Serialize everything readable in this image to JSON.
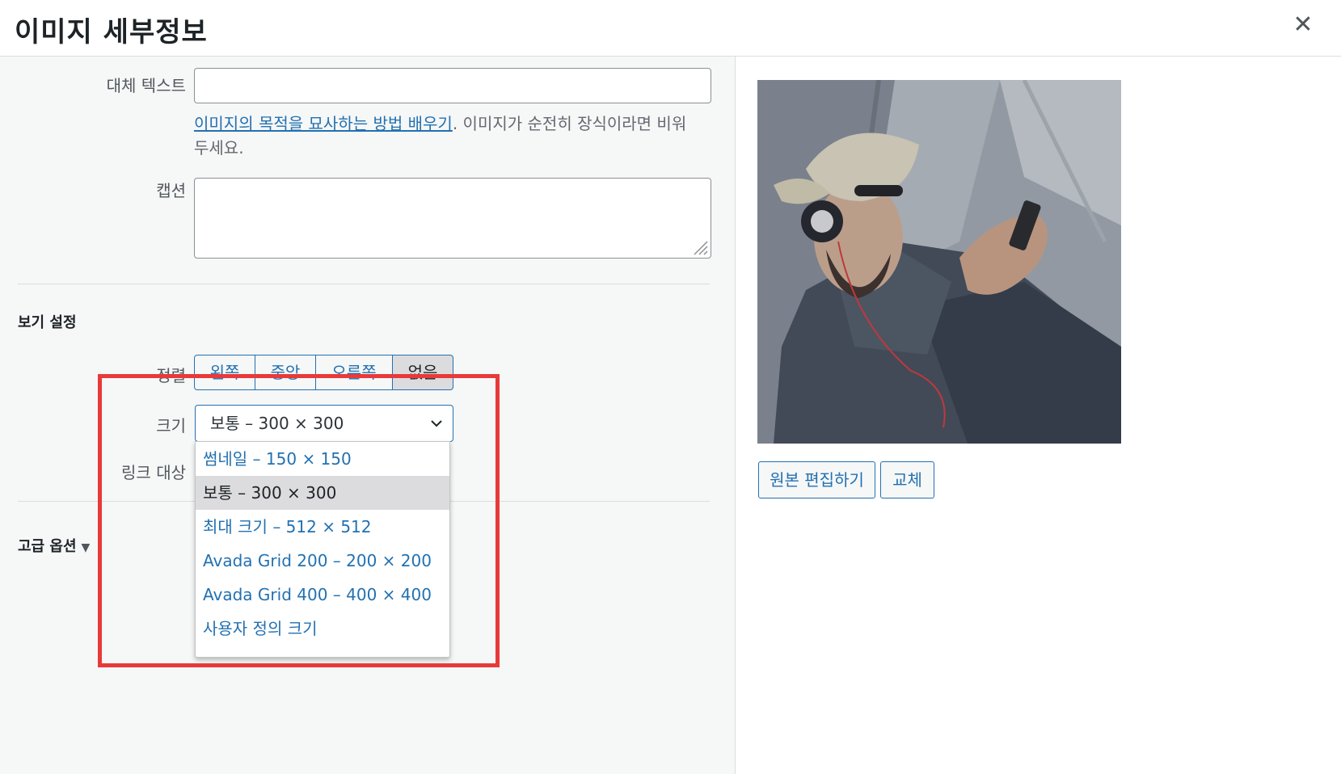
{
  "header": {
    "title": "이미지 세부정보",
    "close_icon": "close-icon"
  },
  "attachment": {
    "alt_label": "대체 텍스트",
    "alt_value": "",
    "help_link": "이미지의 목적을 묘사하는 방법 배우기",
    "help_rest_1": ". 이미지가 순전히 장식이라면 비워",
    "help_rest_2": "두세요.",
    "caption_label": "캡션",
    "caption_value": ""
  },
  "display": {
    "section_title": "보기 설정",
    "align_label": "정렬",
    "align_options": [
      "왼쪽",
      "중앙",
      "오른쪽",
      "없음"
    ],
    "align_selected": "없음",
    "size_label": "크기",
    "size_selected": "보통 – 300 × 300",
    "size_options": [
      "썸네일 – 150 × 150",
      "보통 – 300 × 300",
      "최대 크기 – 512 × 512",
      "Avada Grid 200 – 200 × 200",
      "Avada Grid 400 – 400 × 400",
      "사용자 정의 크기"
    ],
    "link_label": "링크 대상"
  },
  "advanced": {
    "label": "고급 옵션",
    "toggle_icon": "triangle-down-icon"
  },
  "preview": {
    "edit_original_label": "원본 편집하기",
    "replace_label": "교체"
  },
  "colors": {
    "accent": "#2271b1",
    "highlight_box": "#e83a3a",
    "panel_bg": "#f6f7f7"
  }
}
